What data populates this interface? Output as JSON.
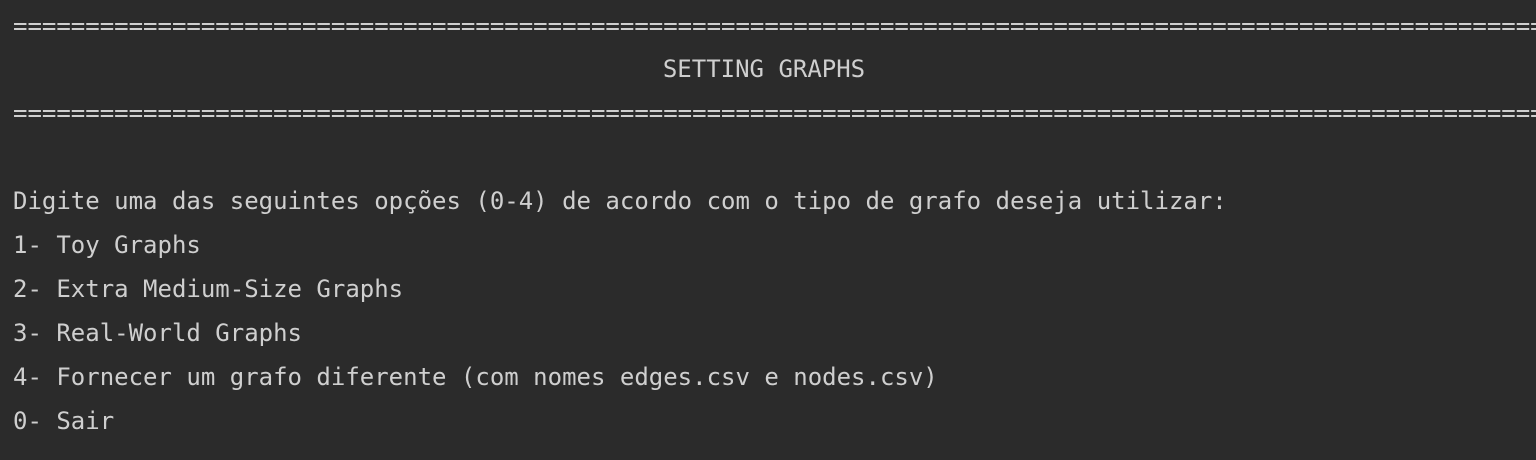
{
  "terminal": {
    "separator_top": "=====================================================================================================================",
    "title": "SETTING GRAPHS",
    "separator_bottom": "=====================================================================================================================",
    "prompt": "Digite uma das seguintes opções (0-4) de acordo com o tipo de grafo deseja utilizar:",
    "options": [
      "1- Toy Graphs",
      "2- Extra Medium-Size Graphs",
      "3- Real-World Graphs",
      "4- Fornecer um grafo diferente (com nomes edges.csv e nodes.csv)",
      "0- Sair"
    ]
  },
  "colors": {
    "background": "#2b2b2b",
    "text": "#cfcfcf"
  }
}
